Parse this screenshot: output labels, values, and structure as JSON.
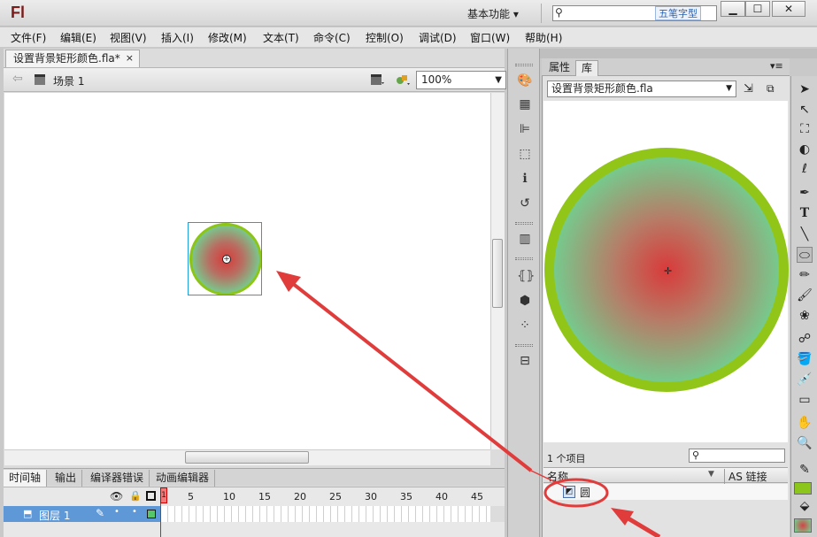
{
  "app": {
    "logo": "Fl",
    "workspace": "基本功能",
    "workspace_arrow": "▾",
    "watermark": "五笔字型"
  },
  "window_buttons": {
    "minimize": "▁",
    "maximize": "☐",
    "close": "✕"
  },
  "menu": [
    "文件(F)",
    "编辑(E)",
    "视图(V)",
    "插入(I)",
    "修改(M)",
    "文本(T)",
    "命令(C)",
    "控制(O)",
    "调试(D)",
    "窗口(W)",
    "帮助(H)"
  ],
  "document": {
    "tab_title": "设置背景矩形颜色.fla*",
    "close": "×",
    "scene": "场景 1",
    "zoom": "100%"
  },
  "timeline": {
    "tabs": [
      "时间轴",
      "输出",
      "编译器错误",
      "动画编辑器"
    ],
    "frame_numbers": [
      "1",
      "5",
      "10",
      "15",
      "20",
      "25",
      "30",
      "35",
      "40",
      "45"
    ],
    "layer_name": "图层 1"
  },
  "library": {
    "tabs": [
      "属性",
      "库"
    ],
    "file": "设置背景矩形颜色.fla",
    "item_count": "1 个项目",
    "col_name": "名称",
    "col_link": "AS 链接",
    "items": [
      {
        "name": "圆"
      }
    ]
  },
  "colors": {
    "stroke": "#8cc51b",
    "fill_center": "#d93a3a",
    "fill_edge": "#6fd795",
    "annotation": "#e03c3c"
  }
}
